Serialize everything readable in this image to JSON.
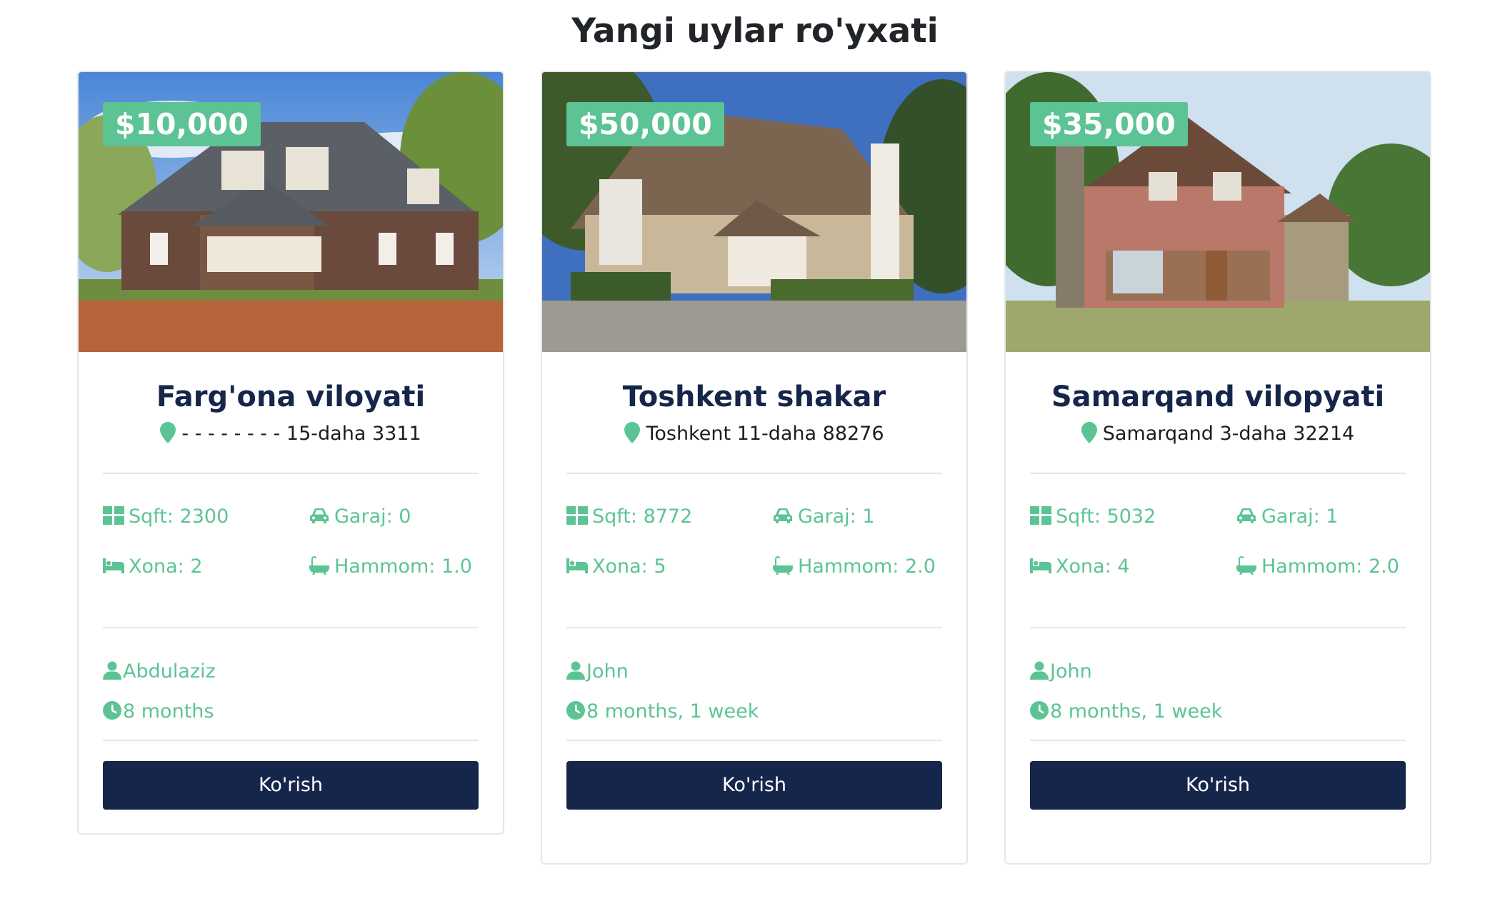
{
  "page": {
    "title": "Yangi uylar ro'yxati"
  },
  "colors": {
    "accent": "#5cc494",
    "navy": "#16264a",
    "divider": "#e6e6e6"
  },
  "listings": [
    {
      "price": "$10,000",
      "name": "Farg'ona viloyati",
      "address": "- - - - - - - - 15-daha 3311",
      "sqft": "Sqft: 2300",
      "garage": "Garaj: 0",
      "rooms": "Xona: 2",
      "bath": "Hammom: 1.0",
      "agent": "Abdulaziz",
      "time": "8 months",
      "button": "Ko'rish"
    },
    {
      "price": "$50,000",
      "name": "Toshkent shakar",
      "address": "Toshkent 11-daha 88276",
      "sqft": "Sqft: 8772",
      "garage": "Garaj: 1",
      "rooms": "Xona: 5",
      "bath": "Hammom: 2.0",
      "agent": "John",
      "time": "8 months, 1 week",
      "button": "Ko'rish"
    },
    {
      "price": "$35,000",
      "name": "Samarqand vilopyati",
      "address": "Samarqand 3-daha 32214",
      "sqft": "Sqft: 5032",
      "garage": "Garaj: 1",
      "rooms": "Xona: 4",
      "bath": "Hammom: 2.0",
      "agent": "John",
      "time": "8 months, 1 week",
      "button": "Ko'rish"
    }
  ],
  "icons": {
    "location": "map-pin-icon",
    "sqft": "grid-icon",
    "garage": "car-icon",
    "rooms": "bed-icon",
    "bath": "bath-icon",
    "agent": "user-icon",
    "time": "clock-icon"
  }
}
